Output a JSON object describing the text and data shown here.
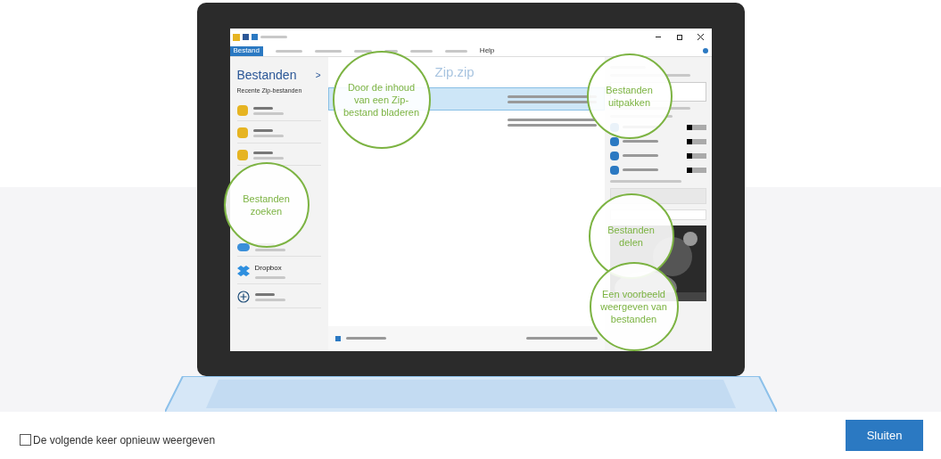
{
  "app": {
    "ribbon_tabs": [
      {
        "label": "Bestand",
        "selected": true
      }
    ],
    "help": "Help",
    "sidebar": {
      "title": "Bestanden",
      "chevron": ">",
      "section": "Recente Zip-bestanden",
      "items": [
        {
          "kind": "zip"
        },
        {
          "kind": "zip"
        },
        {
          "kind": "zip"
        },
        {
          "kind": "cloud"
        },
        {
          "kind": "dropbox",
          "label": "Dropbox"
        },
        {
          "kind": "add"
        }
      ]
    },
    "document_title": "Zip.zip",
    "rows": [
      {
        "selected": true
      },
      {
        "selected": false
      }
    ]
  },
  "callouts": [
    {
      "text": "Door de inhoud van een Zip-bestand bladeren"
    },
    {
      "text": "Bestanden uitpakken"
    },
    {
      "text": "Bestanden zoeken"
    },
    {
      "text": "Bestanden delen"
    },
    {
      "text": "Een voorbeeld weergeven van bestanden"
    }
  ],
  "footer": {
    "checkbox": {
      "label": "De volgende keer opnieuw weergeven",
      "checked": false
    },
    "button": "Sluiten"
  }
}
